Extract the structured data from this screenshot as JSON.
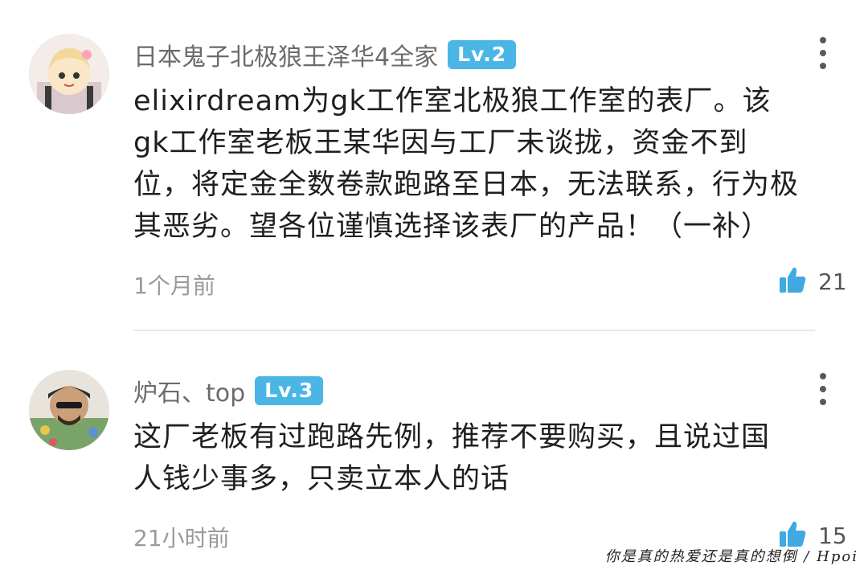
{
  "comments": [
    {
      "username": "日本鬼子北极狼王泽华4全家",
      "level": "Lv.2",
      "lines": [
        "elixirdream为gk工作室北极狼工作室的表厂。该",
        "gk工作室老板王某华因与工厂未谈拢，资金不到",
        "位，将定金全数卷款跑路至日本，无法联系，行为极",
        "其恶劣。望各位谨慎选择该表厂的产品！（一补）"
      ],
      "time": "1个月前",
      "likes": "21"
    },
    {
      "username": "炉石、top",
      "level": "Lv.3",
      "lines": [
        "这厂老板有过跑路先例，推荐不要购买，且说过国",
        "人钱少事多，只卖立本人的话"
      ],
      "time": "21小时前",
      "likes": "15"
    }
  ],
  "watermark": "你是真的热爱还是真的想倒 / Hpoi",
  "colors": {
    "level_badge": "#4ab6e6",
    "like_icon": "#3fa9e2"
  }
}
